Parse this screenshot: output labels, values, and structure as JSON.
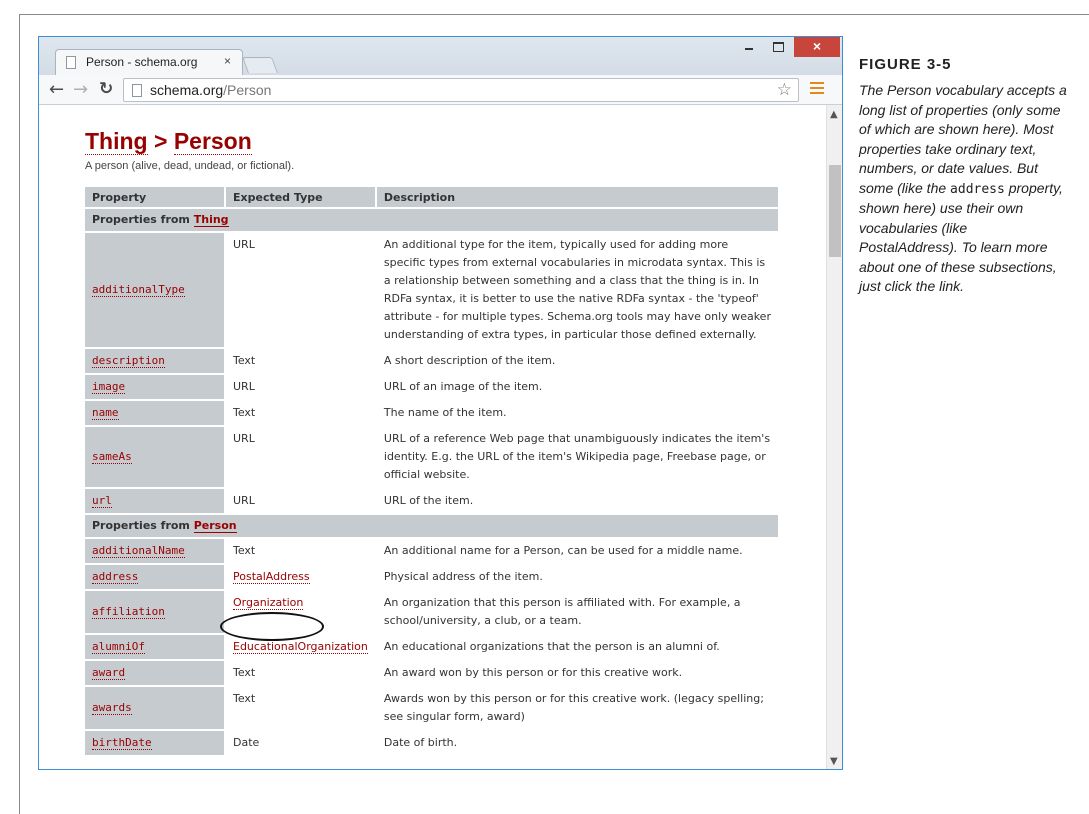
{
  "browser": {
    "tab_title": "Person - schema.org",
    "tab_close": "×",
    "window_close": "×",
    "url_host": "schema.org",
    "url_path": "/Person"
  },
  "page": {
    "heading_parent": "Thing",
    "heading_separator": " > ",
    "heading_current": "Person",
    "subheading": "A person (alive, dead, undead, or fictional)."
  },
  "table": {
    "headers": [
      "Property",
      "Expected Type",
      "Description"
    ],
    "section_prefix": "Properties from ",
    "sections": [
      {
        "name": "Thing",
        "rows": [
          {
            "property": "additionalType",
            "type": "URL",
            "type_is_link": false,
            "description": "An additional type for the item, typically used for adding more specific types from external vocabularies in microdata syntax. This is a relationship between something and a class that the thing is in. In RDFa syntax, it is better to use the native RDFa syntax - the 'typeof' attribute - for multiple types. Schema.org tools may have only weaker understanding of extra types, in particular those defined externally."
          },
          {
            "property": "description",
            "type": "Text",
            "type_is_link": false,
            "description": "A short description of the item."
          },
          {
            "property": "image",
            "type": "URL",
            "type_is_link": false,
            "description": "URL of an image of the item."
          },
          {
            "property": "name",
            "type": "Text",
            "type_is_link": false,
            "description": "The name of the item."
          },
          {
            "property": "sameAs",
            "type": "URL",
            "type_is_link": false,
            "description": "URL of a reference Web page that unambiguously indicates the item's identity. E.g. the URL of the item's Wikipedia page, Freebase page, or official website."
          },
          {
            "property": "url",
            "type": "URL",
            "type_is_link": false,
            "description": "URL of the item."
          }
        ]
      },
      {
        "name": "Person",
        "rows": [
          {
            "property": "additionalName",
            "type": "Text",
            "type_is_link": false,
            "description": "An additional name for a Person, can be used for a middle name."
          },
          {
            "property": "address",
            "type": "PostalAddress",
            "type_is_link": true,
            "description": "Physical address of the item."
          },
          {
            "property": "affiliation",
            "type": "Organization",
            "type_is_link": true,
            "description": "An organization that this person is affiliated with. For example, a school/university, a club, or a team."
          },
          {
            "property": "alumniOf",
            "type": "EducationalOrganization",
            "type_is_link": true,
            "description": "An educational organizations that the person is an alumni of."
          },
          {
            "property": "award",
            "type": "Text",
            "type_is_link": false,
            "description": "An award won by this person or for this creative work."
          },
          {
            "property": "awards",
            "type": "Text",
            "type_is_link": false,
            "description": "Awards won by this person or for this creative work. (legacy spelling; see singular form, award)"
          },
          {
            "property": "birthDate",
            "type": "Date",
            "type_is_link": false,
            "description": "Date of birth."
          }
        ]
      }
    ]
  },
  "caption": {
    "title": "FIGURE 3-5",
    "body_before": "The Person vocabulary accepts a long list of properties (only some of which are shown here). Most properties take ordinary text, numbers, or date values. But some (like the ",
    "body_code": "address",
    "body_after": " property, shown here) use their own vocabularies (like PostalAddress). To learn more about one of these subsections, just click the link."
  },
  "colors": {
    "link": "#990000",
    "table_header_bg": "#c6cbd0",
    "window_close_bg": "#c7453b",
    "menu_accent": "#e08a1e"
  }
}
